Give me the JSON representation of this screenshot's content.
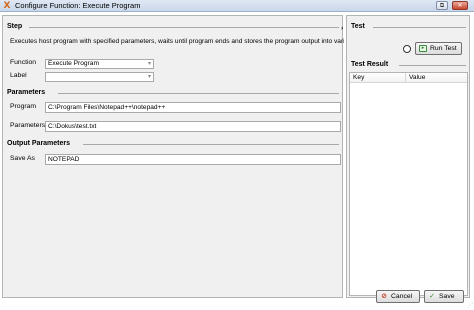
{
  "window": {
    "title": "Configure Function: Execute Program",
    "icons": {
      "app": "x-logo-icon",
      "restore": "restore-icon",
      "close": "close-icon"
    },
    "restore_glyph": "⧉",
    "close_glyph": "✕",
    "app_glyph": "X"
  },
  "step": {
    "header": "Step",
    "description": "Executes host program with specified parameters, waits until program ends and stores the program output into variable specifi",
    "function_label": "Function",
    "function_value": "Execute Program",
    "label_label": "Label",
    "label_value": ""
  },
  "parameters": {
    "header": "Parameters",
    "program_label": "Program",
    "program_value": "C:\\Program Files\\Notepad++\\notepad++",
    "parameters_label": "Parameters",
    "parameters_value": "C:\\Dokus\\test.txt"
  },
  "output": {
    "header": "Output Parameters",
    "save_as_label": "Save As",
    "save_as_value": "NOTEPAD"
  },
  "test": {
    "header": "Test",
    "run_button": "Run Test",
    "run_icon": "run-icon",
    "result_header": "Test Result",
    "columns": [
      "Key",
      "Value"
    ]
  },
  "buttons": {
    "cancel": "Cancel",
    "save": "Save",
    "cancel_icon": "cancel-icon",
    "save_icon": "checkmark-icon"
  },
  "colors": {
    "pane_background": "#f0f0f0",
    "title_gradient_top": "#dfe8f4",
    "cancel_icon": "#c0301f",
    "save_icon": "#2f8f2f"
  }
}
